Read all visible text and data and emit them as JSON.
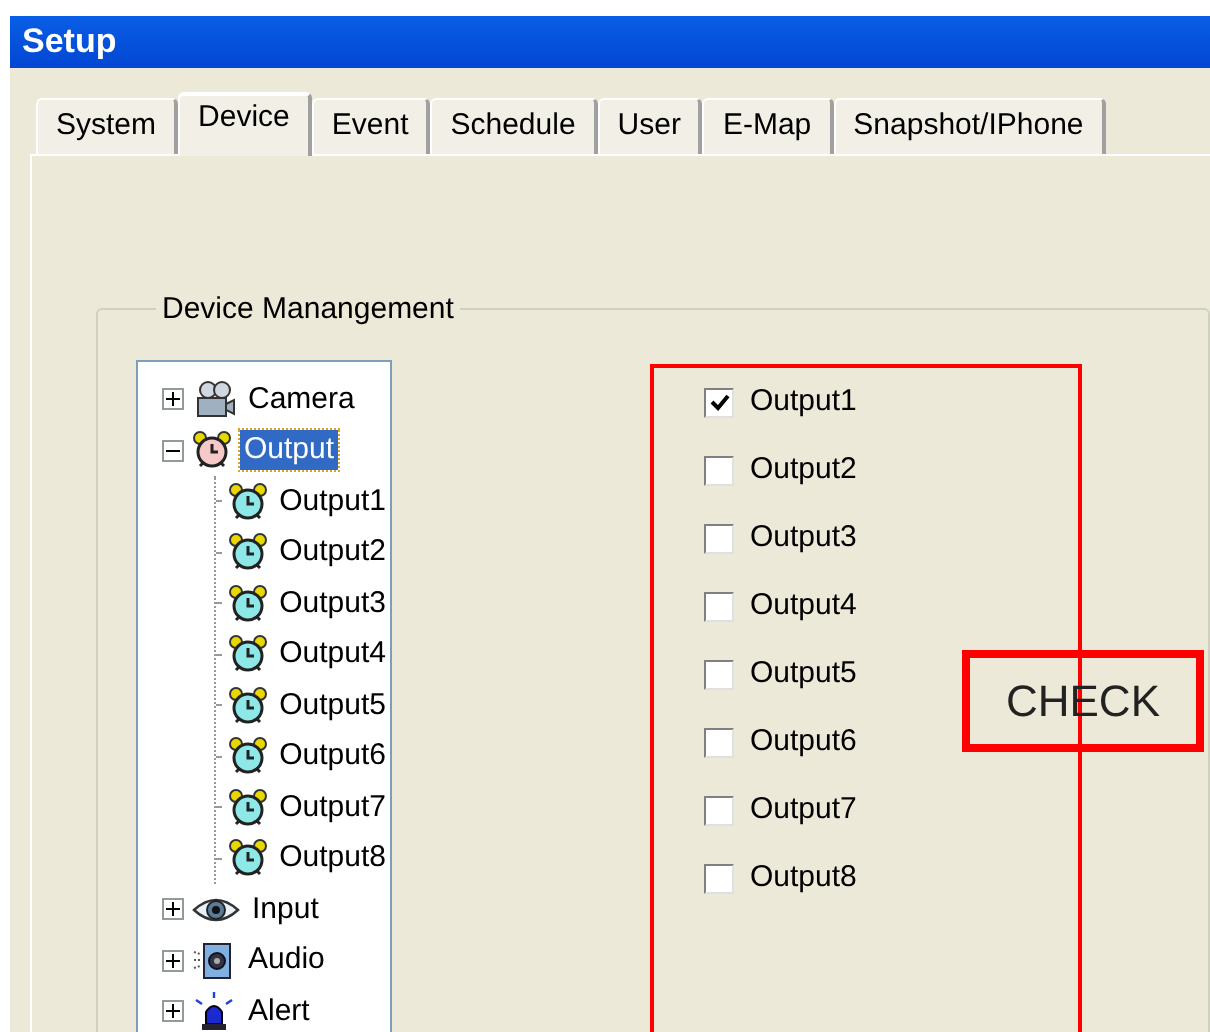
{
  "window": {
    "title": "Setup"
  },
  "tabs": [
    {
      "label": "System",
      "selected": false
    },
    {
      "label": "Device",
      "selected": true
    },
    {
      "label": "Event",
      "selected": false
    },
    {
      "label": "Schedule",
      "selected": false
    },
    {
      "label": "User",
      "selected": false
    },
    {
      "label": "E-Map",
      "selected": false
    },
    {
      "label": "Snapshot/IPhone",
      "selected": false
    }
  ],
  "group": {
    "title": "Device Manangement"
  },
  "tree": [
    {
      "label": "Camera",
      "kind": "camera",
      "expanded": false,
      "selected": false
    },
    {
      "label": "Output",
      "kind": "output",
      "expanded": true,
      "selected": true,
      "children": [
        {
          "label": "Output1",
          "kind": "output-item",
          "selected": false
        },
        {
          "label": "Output2",
          "kind": "output-item",
          "selected": false
        },
        {
          "label": "Output3",
          "kind": "output-item",
          "selected": false
        },
        {
          "label": "Output4",
          "kind": "output-item",
          "selected": false
        },
        {
          "label": "Output5",
          "kind": "output-item",
          "selected": false
        },
        {
          "label": "Output6",
          "kind": "output-item",
          "selected": false
        },
        {
          "label": "Output7",
          "kind": "output-item",
          "selected": false
        },
        {
          "label": "Output8",
          "kind": "output-item",
          "selected": false
        }
      ]
    },
    {
      "label": "Input",
      "kind": "input",
      "expanded": false,
      "selected": false
    },
    {
      "label": "Audio",
      "kind": "audio",
      "expanded": false,
      "selected": false
    },
    {
      "label": "Alert",
      "kind": "alert",
      "expanded": false,
      "selected": false
    }
  ],
  "outputs": [
    {
      "label": "Output1",
      "checked": true
    },
    {
      "label": "Output2",
      "checked": false
    },
    {
      "label": "Output3",
      "checked": false
    },
    {
      "label": "Output4",
      "checked": false
    },
    {
      "label": "Output5",
      "checked": false
    },
    {
      "label": "Output6",
      "checked": false
    },
    {
      "label": "Output7",
      "checked": false
    },
    {
      "label": "Output8",
      "checked": false
    }
  ],
  "annotation": {
    "label": "CHECK"
  }
}
